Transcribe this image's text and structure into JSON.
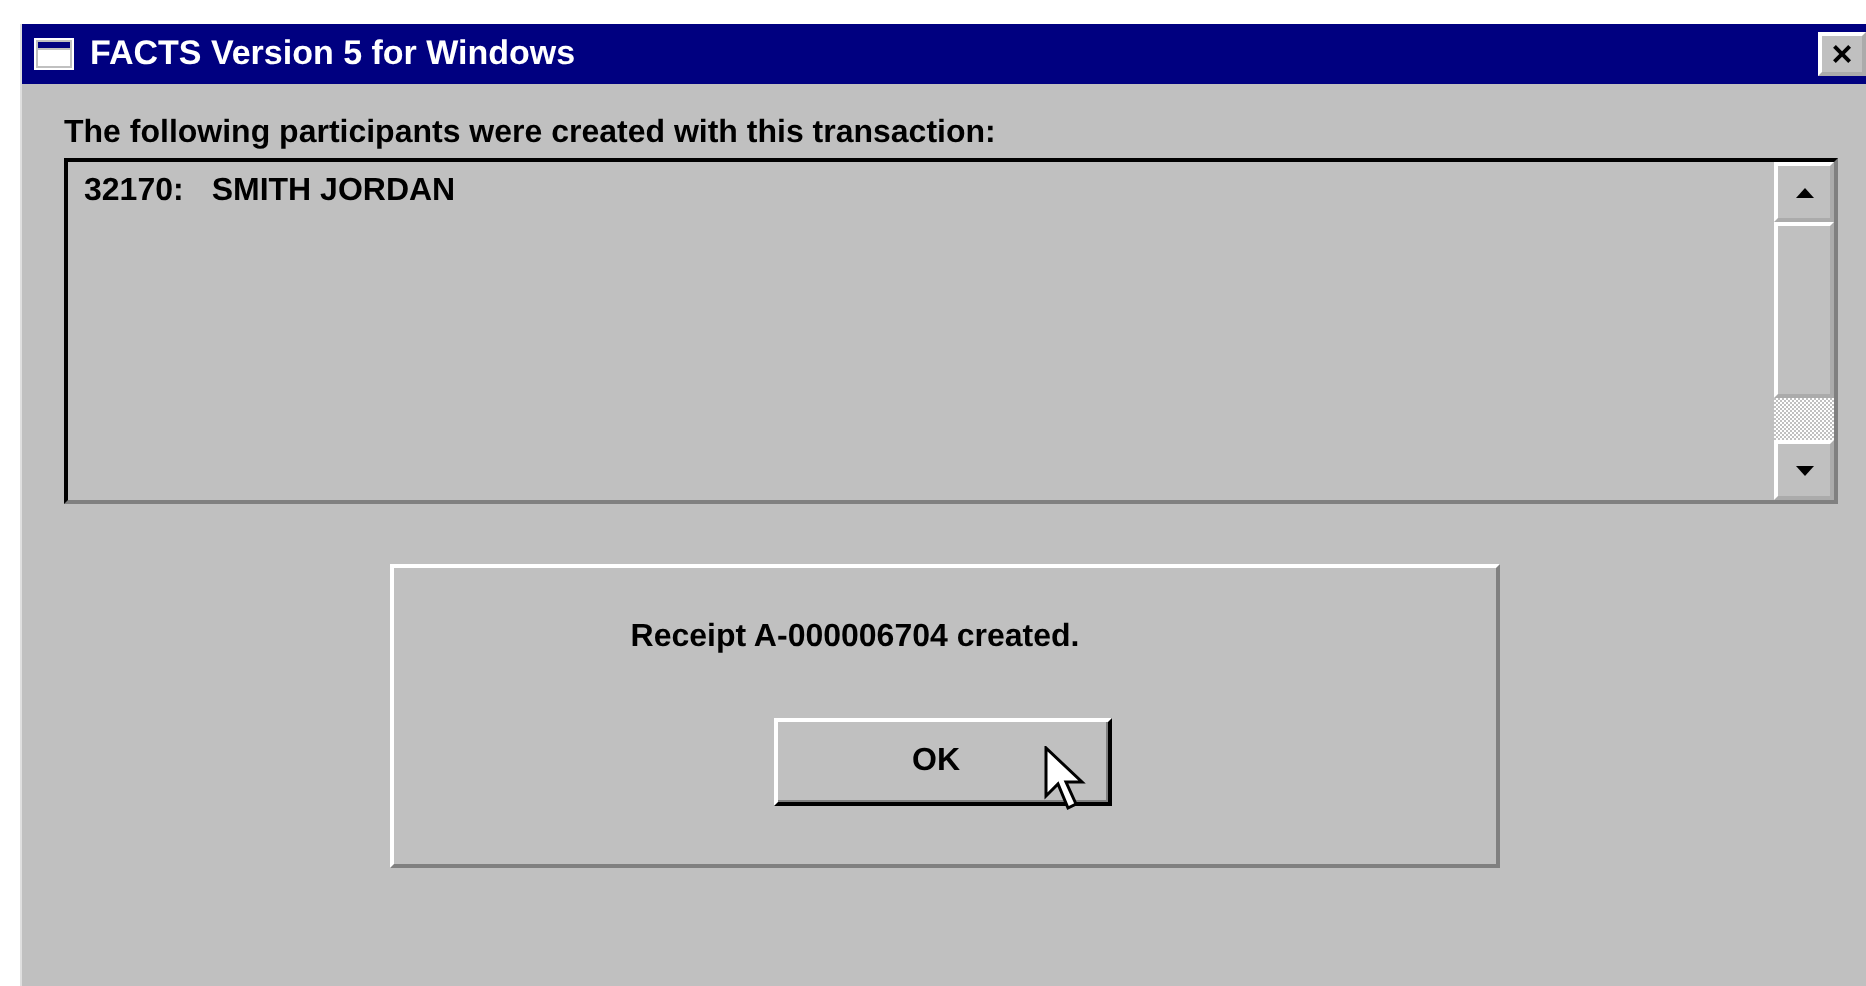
{
  "window": {
    "title": "FACTS Version 5 for Windows",
    "close": "×"
  },
  "participants": {
    "label": "The following participants were created with this transaction:",
    "items": [
      {
        "id": "32170:",
        "name": "SMITH JORDAN"
      }
    ]
  },
  "receipt": {
    "message": "Receipt A-000006704 created.",
    "button": "OK"
  }
}
